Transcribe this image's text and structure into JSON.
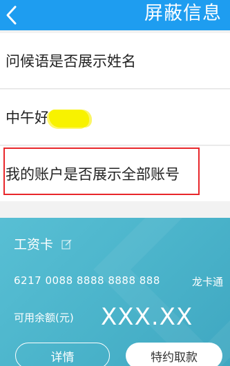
{
  "header": {
    "back_icon": "chevron-left-icon",
    "title": "屏蔽信息",
    "bg_color": "#1e9df0"
  },
  "settings": {
    "row1_label": "问候语是否展示姓名",
    "greeting_preview": "中午好",
    "row3_label": "我的账户是否展示全部账号"
  },
  "card": {
    "title": "工资卡",
    "edit_icon": "edit-icon",
    "number": "6217 0088 8888 8888 888",
    "brand": "龙卡通",
    "balance_label": "可用余额(元)",
    "balance_value": "XXX.XX",
    "detail_button": "详情",
    "special_button": "特约取款",
    "bg_color": "#4ab3ca"
  },
  "annotation": {
    "highlight_color": "#e8262a"
  }
}
